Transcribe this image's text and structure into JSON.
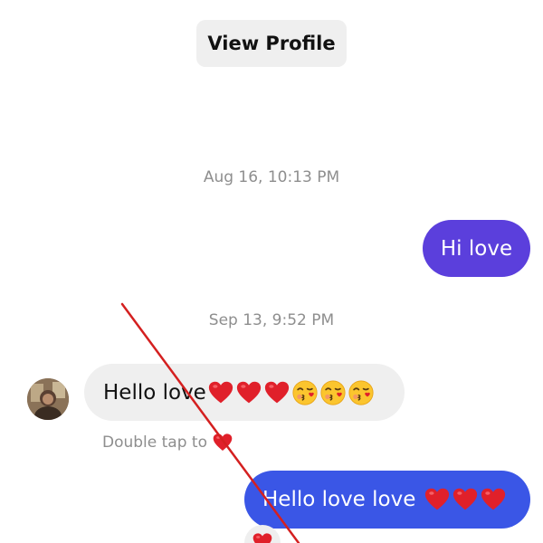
{
  "header": {
    "view_profile_label": "View Profile"
  },
  "thread": {
    "timestamps": [
      "Aug 16, 10:13 PM",
      "Sep 13, 9:52 PM"
    ],
    "messages": [
      {
        "text": "Hi love",
        "direction": "sent"
      },
      {
        "text": "Hello love",
        "direction": "received",
        "emoji": [
          "heart",
          "heart",
          "heart",
          "kissing-face",
          "kissing-face",
          "kissing-face"
        ]
      },
      {
        "text": "Hello love love",
        "direction": "sent",
        "emoji": [
          "heart",
          "heart",
          "heart"
        ]
      }
    ],
    "hint": "Double tap to",
    "reaction": "heart"
  },
  "colors": {
    "sent_bubble_purple": "#5b3fdc",
    "sent_bubble_blue": "#3a56e6",
    "received_bubble": "#efefef",
    "timestamp_text": "#8e8e8e",
    "annotation_line": "#d42020",
    "heart": "#e0202a"
  }
}
